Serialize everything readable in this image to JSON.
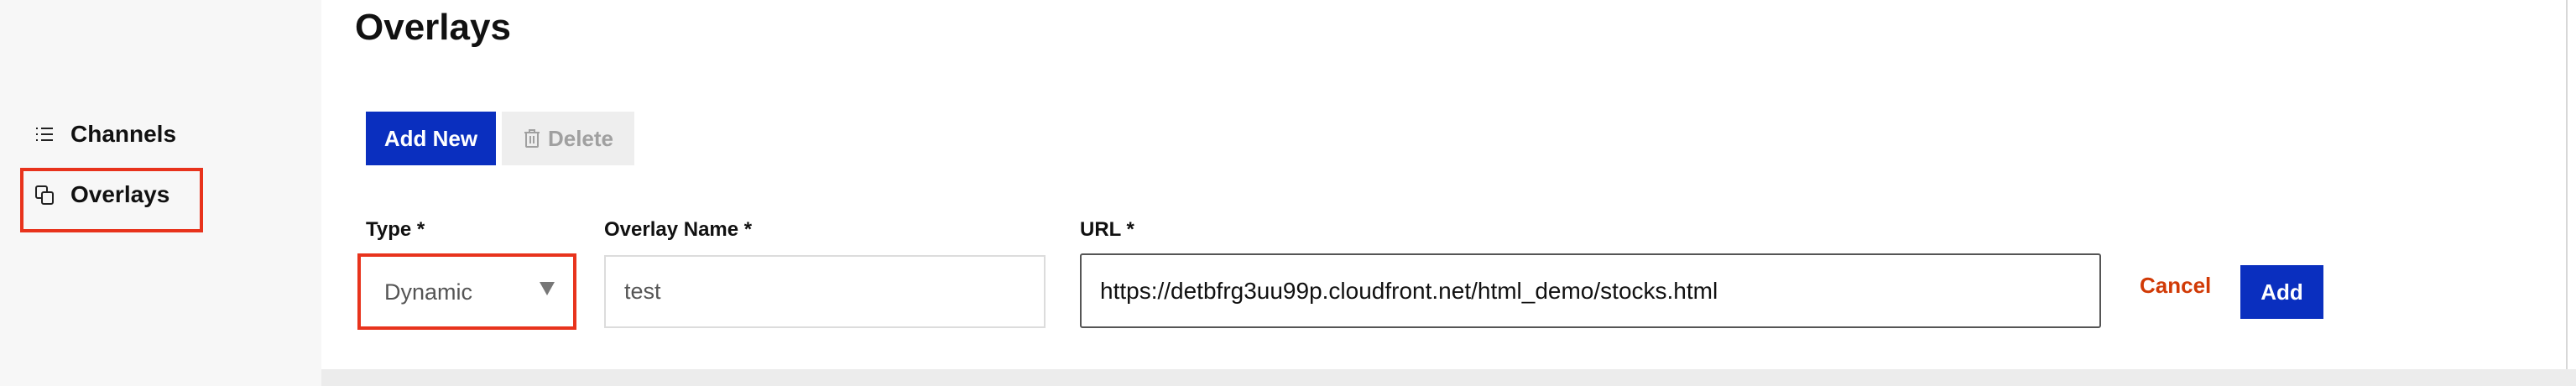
{
  "sidebar": {
    "items": [
      {
        "label": "Channels",
        "icon": "list-icon"
      },
      {
        "label": "Overlays",
        "icon": "copy-icon"
      }
    ]
  },
  "main": {
    "title": "Overlays",
    "toolbar": {
      "add_new_label": "Add New",
      "delete_label": "Delete"
    },
    "form": {
      "type": {
        "label": "Type *",
        "value": "Dynamic"
      },
      "overlay_name": {
        "label": "Overlay Name *",
        "value": "test"
      },
      "url": {
        "label": "URL *",
        "value": "https://detbfrg3uu99p.cloudfront.net/html_demo/stocks.html"
      },
      "cancel_label": "Cancel",
      "add_label": "Add"
    }
  },
  "colors": {
    "accent": "#0a2fbf",
    "cancel": "#d13a06",
    "highlight": "#e8331c"
  }
}
